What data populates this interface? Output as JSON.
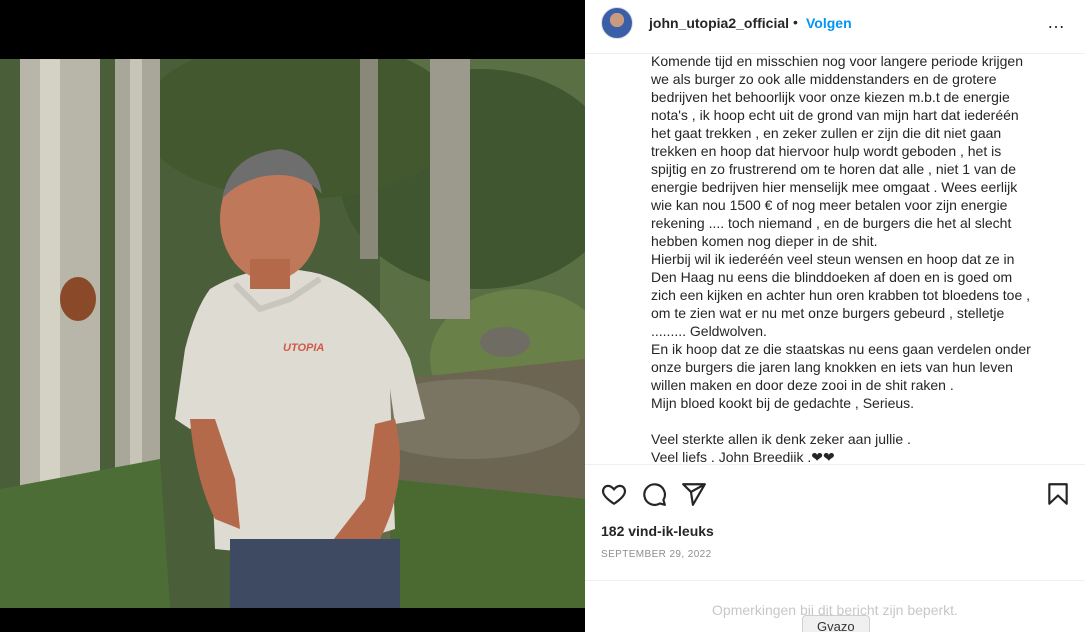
{
  "post": {
    "username": "john_utopia2_official",
    "separator": "•",
    "follow_label": "Volgen",
    "more_icon": "…",
    "caption": "Komende tijd en misschien nog voor langere periode krijgen\nwe als burger zo ook alle middenstanders en de grotere\nbedrijven het behoorlijk voor onze kiezen m.b.t de energie\nnota's , ik hoop echt uit de grond van mijn hart dat iederéén\nhet gaat trekken , en zeker zullen er zijn die dit niet gaan\ntrekken en hoop dat hiervoor hulp wordt geboden , het is\nspijtig en zo frustrerend om te horen dat alle , niet 1 van de\nenergie bedrijven hier menselijk mee omgaat . Wees eerlijk\nwie kan nou 1500 € of nog meer betalen voor zijn energie\nrekening .... toch niemand , en de burgers die het al slecht\nhebben komen nog dieper in de shit.\nHierbij wil ik iederéén veel steun wensen en hoop dat ze in\nDen Haag nu eens die blinddoeken af doen en is goed om\nzich een kijken en achter hun oren krabben tot bloedens toe ,\nom te zien wat er nu met onze burgers gebeurd , stelletje\n......... Geldwolven.\nEn ik hoop dat ze die staatskas nu eens gaan verdelen onder\nonze burgers die jaren lang knokken en iets van hun leven\nwillen maken en door deze zooi in de shit raken .\nMijn bloed kookt bij de gedachte , Serieus.\n\nVeel sterkte allen ik denk zeker aan jullie .\nVeel liefs , John Breedijk .❤❤",
    "likes": "182 vind-ik-leuks",
    "date": "SEPTEMBER 29, 2022",
    "comments_restricted": "Opmerkingen bij dit bericht zijn beperkt.",
    "gvazo_label": "Gvazo",
    "shirt_logo": "UTOPIA"
  },
  "icons": {
    "like": "heart-icon",
    "comment": "comment-icon",
    "share": "share-icon",
    "save": "bookmark-icon"
  },
  "colors": {
    "accent": "#0095f6",
    "text": "#262626",
    "muted": "#8e8e8e"
  }
}
